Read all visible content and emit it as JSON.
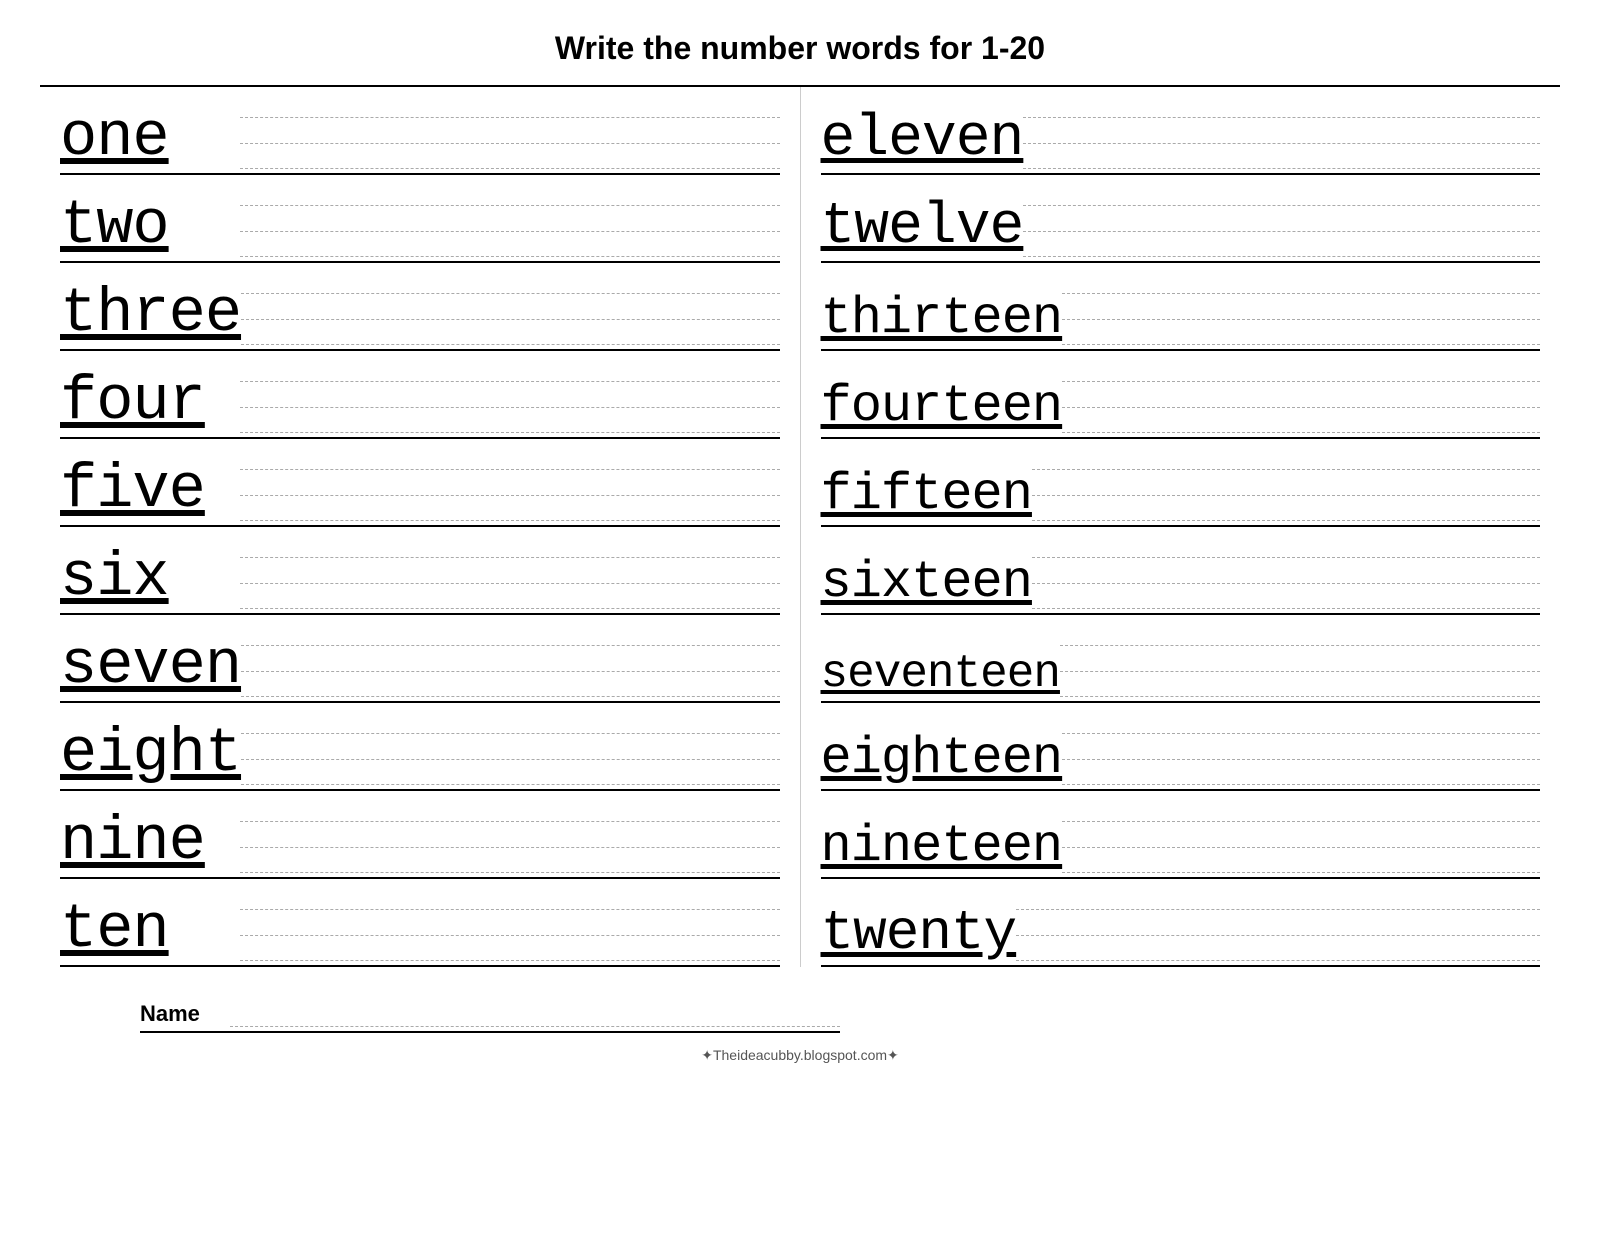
{
  "title": "Write the number words for  1-20",
  "left_column": [
    {
      "label": "one",
      "class": ""
    },
    {
      "label": "two",
      "class": ""
    },
    {
      "label": "three",
      "class": ""
    },
    {
      "label": "four",
      "class": ""
    },
    {
      "label": "five",
      "class": ""
    },
    {
      "label": "six",
      "class": ""
    },
    {
      "label": "seven",
      "class": ""
    },
    {
      "label": "eight",
      "class": ""
    },
    {
      "label": "nine",
      "class": ""
    },
    {
      "label": "ten",
      "class": ""
    }
  ],
  "right_column": [
    {
      "label": "eleven",
      "class": "eleven"
    },
    {
      "label": "twelve",
      "class": "twelve"
    },
    {
      "label": "thirteen",
      "class": "thirteen"
    },
    {
      "label": "fourteen",
      "class": "fourteen"
    },
    {
      "label": "fifteen",
      "class": "fifteen"
    },
    {
      "label": "sixteen",
      "class": "sixteen"
    },
    {
      "label": "seventeen",
      "class": "seventeen"
    },
    {
      "label": "eighteen",
      "class": "eighteen"
    },
    {
      "label": "nineteen",
      "class": "nineteen"
    },
    {
      "label": "twenty",
      "class": "twenty"
    }
  ],
  "name_label": "Name",
  "footer": "✦Theideacubby.blogspot.com✦"
}
